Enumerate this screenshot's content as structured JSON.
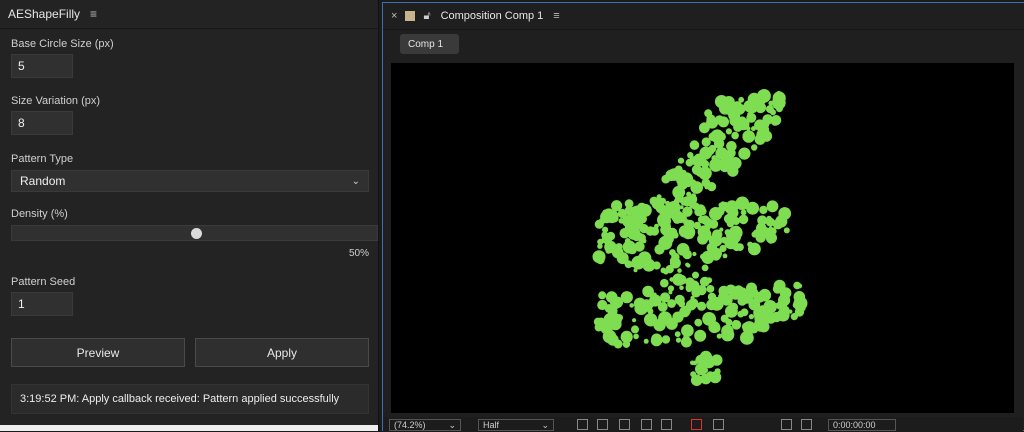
{
  "plugin_panel": {
    "title": "AEShapeFilly",
    "fields": {
      "base_circle_size": {
        "label": "Base Circle Size (px)",
        "value": "5"
      },
      "size_variation": {
        "label": "Size Variation (px)",
        "value": "8"
      },
      "pattern_type": {
        "label": "Pattern Type",
        "value": "Random"
      },
      "density": {
        "label": "Density (%)",
        "value": 50,
        "display": "50%"
      },
      "pattern_seed": {
        "label": "Pattern Seed",
        "value": "1"
      }
    },
    "buttons": {
      "preview": "Preview",
      "apply": "Apply"
    },
    "status": "3:19:52 PM: Apply callback received: Pattern applied successfully"
  },
  "composition_panel": {
    "title": "Composition Comp 1",
    "tab": "Comp 1",
    "toolbar": {
      "zoom": "(74.2%)",
      "resolution": "Half",
      "timecode": "0:00:00:00"
    },
    "dot_color": "#7fdd52"
  }
}
